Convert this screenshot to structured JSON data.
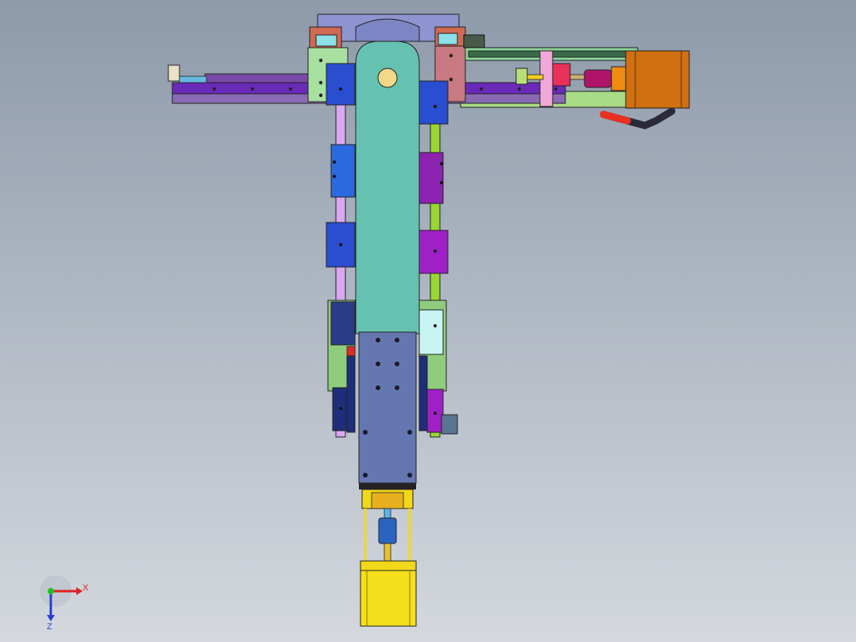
{
  "viewport": {
    "background_top": "#8e9aaa",
    "background_bottom": "#d4d8de"
  },
  "triad": {
    "x_label": "X",
    "z_label": "Z",
    "x_color": "#e02020",
    "z_color": "#2a3cd0",
    "origin_color": "#20c020"
  },
  "colors": {
    "arm_teal": "#66c2b0",
    "block_blue": "#2a5fd8",
    "block_purple": "#8c22b0",
    "rail_violet": "#6a2ab8",
    "plate_slate": "#6577b0",
    "motor_yellow": "#f2d81a",
    "motor_orange": "#d07010",
    "rail_green": "#9ad632",
    "rail_lilac": "#d8a8f0"
  }
}
